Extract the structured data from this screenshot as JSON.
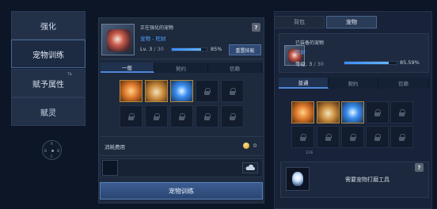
{
  "nav": {
    "items": [
      {
        "label": "强化"
      },
      {
        "label": "宠物训练"
      },
      {
        "label": "赋予属性",
        "badge": "TIL"
      },
      {
        "label": "赋灵"
      }
    ]
  },
  "compass": {
    "labels": [
      "A",
      "B",
      "C",
      "D"
    ]
  },
  "training": {
    "status_label": "正在强化的宠物",
    "pet_name": "宠物 - 旺财",
    "level_text": "Lv. 3",
    "level_max": "/ 30",
    "progress_percent": 85,
    "progress_text": "85%",
    "reset_button": "重置技能",
    "help": "?",
    "tabs": [
      "一般",
      "契约",
      "信赖"
    ],
    "cost_label": "消耗费用",
    "cost_value": "0",
    "main_button": "宠物训练"
  },
  "equipped": {
    "tabs": [
      "背包",
      "宠物"
    ],
    "label": "已装备的宠物",
    "pet_name": "旺财",
    "level_label": "等级.",
    "level_value": "3",
    "level_max": "/ 30",
    "progress_percent": 85.59,
    "progress_text": "85.59%",
    "sub_tabs": [
      "普通",
      "契约",
      "信赖"
    ],
    "tick_mark": "1/16",
    "hint": "需要宠物打磨工具",
    "help": "?"
  }
}
